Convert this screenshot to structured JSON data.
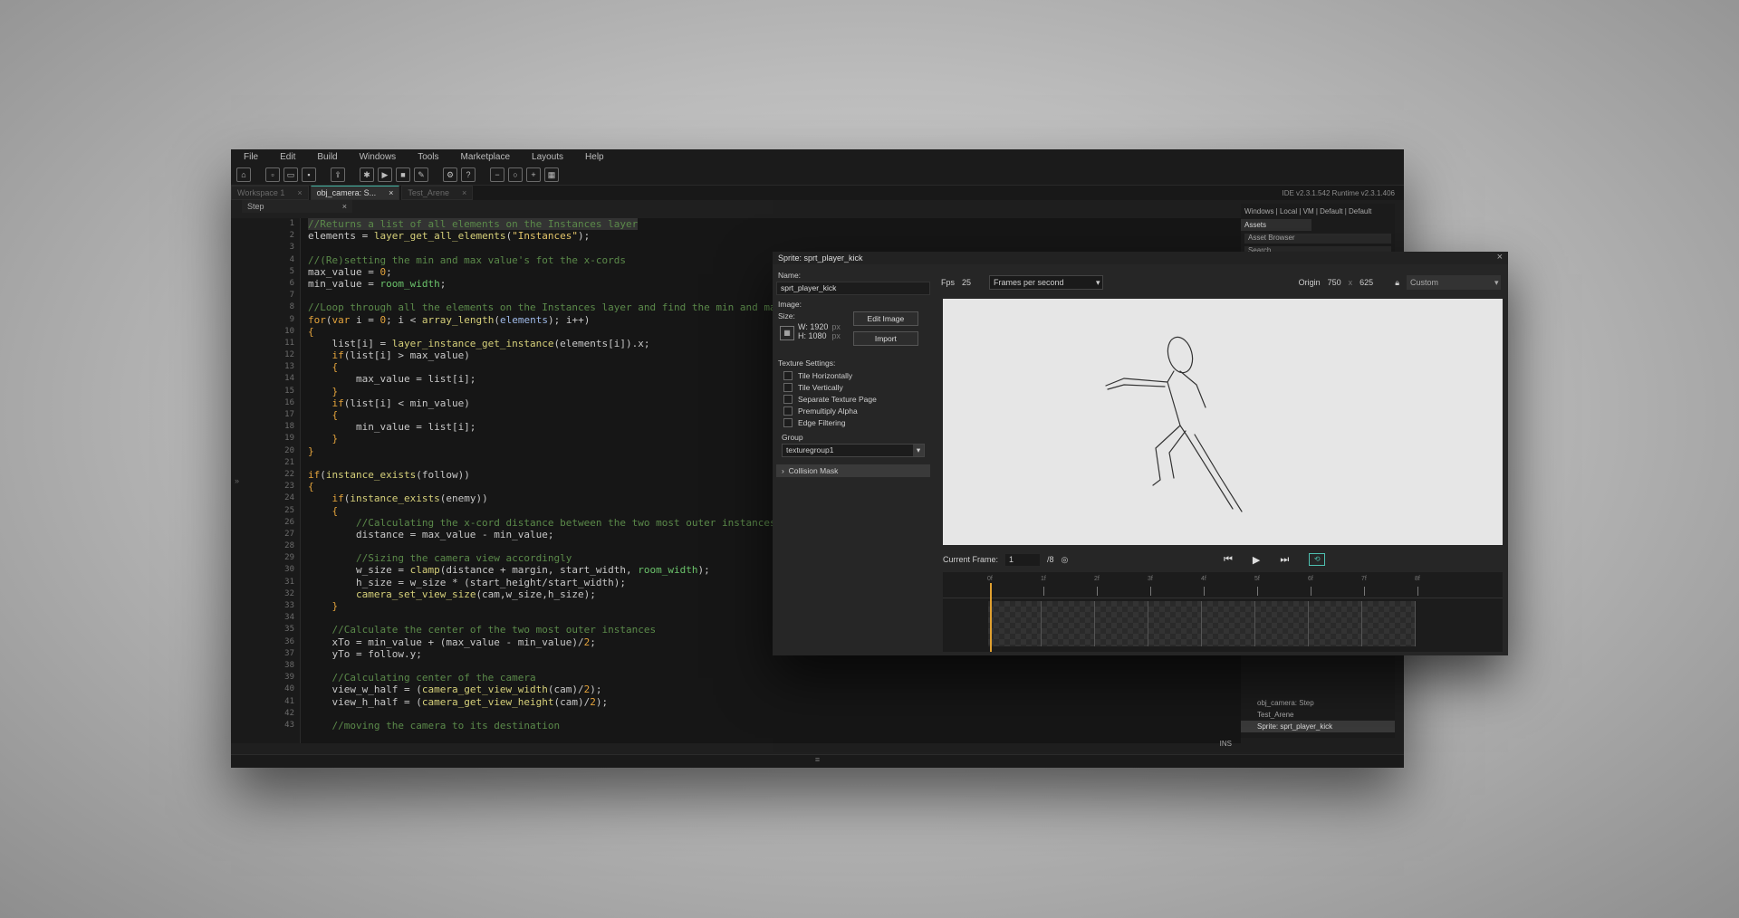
{
  "ide": {
    "menu": [
      "File",
      "Edit",
      "Build",
      "Windows",
      "Tools",
      "Marketplace",
      "Layouts",
      "Help"
    ],
    "version": "IDE v2.3.1.542  Runtime v2.3.1.406",
    "tabs": [
      {
        "label": "Workspace 1",
        "active": false
      },
      {
        "label": "obj_camera: S...",
        "active": true
      },
      {
        "label": "Test_Arene",
        "active": false
      }
    ],
    "event_tab": "Step",
    "ins_label": "INS",
    "assets": {
      "top_links": "Windows | Local | VM | Default | Default",
      "tab": "Assets",
      "browser_label": "Asset Browser",
      "search_placeholder": "Search...",
      "list": [
        "obj_camera: Step",
        "Test_Arene",
        "Sprite: sprt_player_kick"
      ]
    }
  },
  "code": {
    "line_numbers": [
      "1",
      "2",
      "3",
      "4",
      "5",
      "6",
      "7",
      "8",
      "9",
      "10",
      "11",
      "12",
      "13",
      "14",
      "15",
      "16",
      "17",
      "18",
      "19",
      "20",
      "21",
      "22",
      "23",
      "24",
      "25",
      "26",
      "27",
      "28",
      "29",
      "30",
      "31",
      "32",
      "33",
      "34",
      "35",
      "36",
      "37",
      "38",
      "39",
      "40",
      "41",
      "42",
      "43"
    ]
  },
  "sprite": {
    "title": "Sprite: sprt_player_kick",
    "name_label": "Name:",
    "name_value": "sprt_player_kick",
    "image_label": "Image:",
    "size_label": "Size:",
    "width": "W: 1920",
    "height": "H: 1080",
    "px_unit": "px",
    "edit_image_button": "Edit Image",
    "import_button": "Import",
    "texture_settings_label": "Texture Settings:",
    "texture_options": [
      "Tile Horizontally",
      "Tile Vertically",
      "Separate Texture Page",
      "Premultiply Alpha",
      "Edge Filtering"
    ],
    "group_label": "Group",
    "group_value": "texturegroup1",
    "collision_mask_label": "Collision Mask",
    "fps_label": "Fps",
    "fps_value": "25",
    "fps_mode": "Frames per second",
    "origin_label": "Origin",
    "origin_x": "750",
    "origin_sep": "x",
    "origin_y": "625",
    "origin_preset": "Custom",
    "current_frame_label": "Current Frame:",
    "current_frame_value": "1",
    "frame_total": "/8",
    "timeline_ticks": [
      "0f",
      "1f",
      "2f",
      "3f",
      "4f",
      "5f",
      "6f",
      "7f",
      "8f"
    ]
  }
}
